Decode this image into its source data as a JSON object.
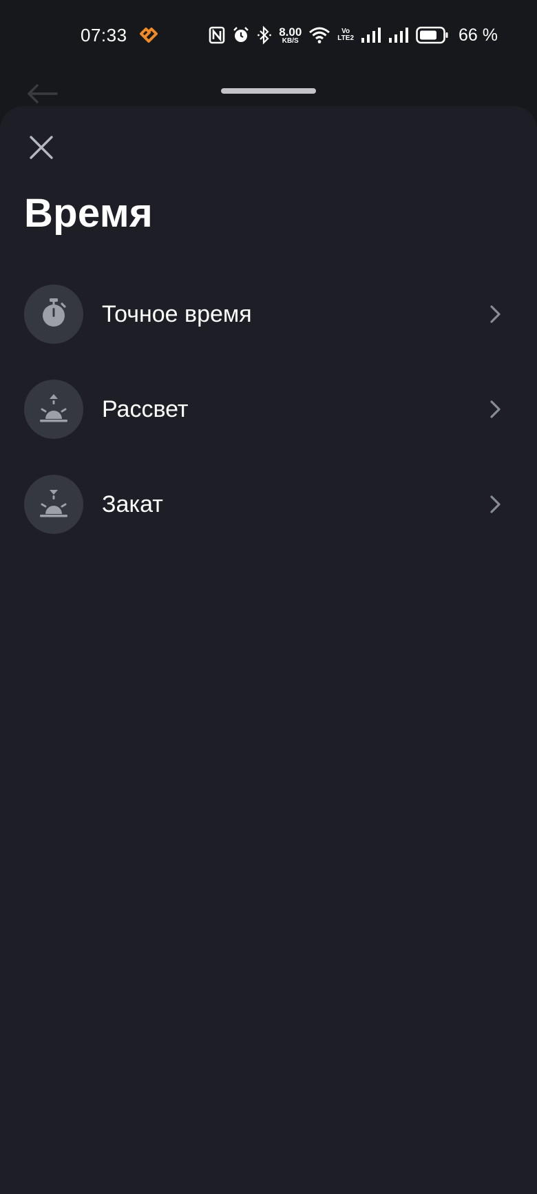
{
  "status_bar": {
    "time": "07:33",
    "net_speed_value": "8.00",
    "net_speed_unit": "KB/S",
    "volte_top": "Vo",
    "volte_bottom": "LTE2",
    "battery_percent": "66 %",
    "icons": [
      "app-notification-icon",
      "nfc-icon",
      "alarm-icon",
      "bluetooth-icon",
      "wifi-icon",
      "signal-icon",
      "signal-icon",
      "battery-icon"
    ]
  },
  "underlay": {
    "back_icon": "arrow-left-icon"
  },
  "sheet": {
    "title": "Время",
    "close_icon": "close-icon",
    "items": [
      {
        "label": "Точное время",
        "icon": "stopwatch-icon"
      },
      {
        "label": "Рассвет",
        "icon": "sunrise-icon"
      },
      {
        "label": "Закат",
        "icon": "sunset-icon"
      }
    ]
  },
  "colors": {
    "background": "#17181c",
    "sheet": "#1e1f26",
    "icon_circle": "#363840",
    "icon_glyph": "#9ea0a8",
    "chevron": "#8a8c94",
    "app_icon_accent": "#f08a24"
  }
}
